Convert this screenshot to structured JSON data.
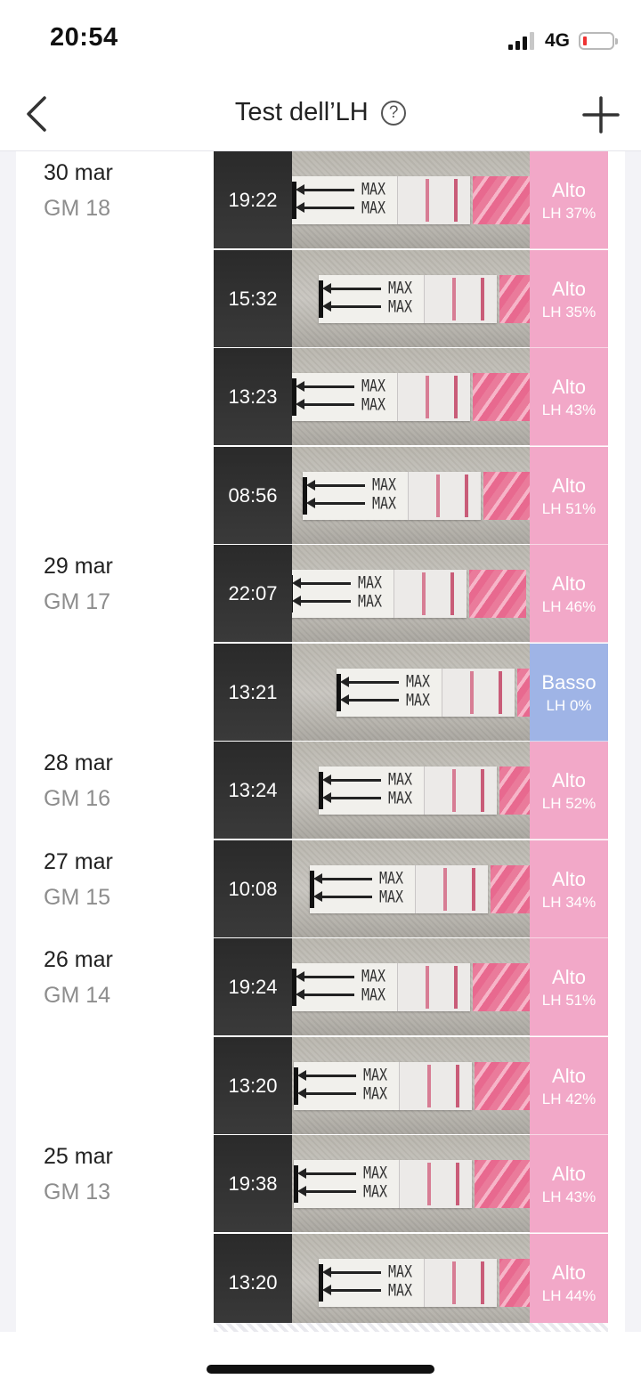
{
  "status_bar": {
    "time": "20:54",
    "network": "4G",
    "signal_bars": 3,
    "battery_level": "low"
  },
  "nav": {
    "title": "Test dell’LH",
    "back_icon": "chevron-left-icon",
    "help_icon": "question-circle-icon",
    "help_symbol": "?",
    "add_icon": "plus-icon"
  },
  "strip_label": "MAX",
  "entries": [
    {
      "date": "30 mar",
      "cycle_day": "GM 18",
      "time": "19:22",
      "level": "Alto",
      "lh": "LH 37%",
      "status": "high"
    },
    {
      "date": "",
      "cycle_day": "",
      "time": "15:32",
      "level": "Alto",
      "lh": "LH 35%",
      "status": "high"
    },
    {
      "date": "",
      "cycle_day": "",
      "time": "13:23",
      "level": "Alto",
      "lh": "LH 43%",
      "status": "high"
    },
    {
      "date": "",
      "cycle_day": "",
      "time": "08:56",
      "level": "Alto",
      "lh": "LH 51%",
      "status": "high"
    },
    {
      "date": "29 mar",
      "cycle_day": "GM 17",
      "time": "22:07",
      "level": "Alto",
      "lh": "LH 46%",
      "status": "high"
    },
    {
      "date": "",
      "cycle_day": "",
      "time": "13:21",
      "level": "Basso",
      "lh": "LH 0%",
      "status": "low"
    },
    {
      "date": "28 mar",
      "cycle_day": "GM 16",
      "time": "13:24",
      "level": "Alto",
      "lh": "LH 52%",
      "status": "high"
    },
    {
      "date": "27 mar",
      "cycle_day": "GM 15",
      "time": "10:08",
      "level": "Alto",
      "lh": "LH 34%",
      "status": "high"
    },
    {
      "date": "26 mar",
      "cycle_day": "GM 14",
      "time": "19:24",
      "level": "Alto",
      "lh": "LH 51%",
      "status": "high"
    },
    {
      "date": "",
      "cycle_day": "",
      "time": "13:20",
      "level": "Alto",
      "lh": "LH 42%",
      "status": "high"
    },
    {
      "date": "25 mar",
      "cycle_day": "GM 13",
      "time": "19:38",
      "level": "Alto",
      "lh": "LH 43%",
      "status": "high"
    },
    {
      "date": "",
      "cycle_day": "",
      "time": "13:20",
      "level": "Alto",
      "lh": "LH 44%",
      "status": "high"
    }
  ],
  "colors": {
    "high": "#f2a8c8",
    "low": "#9fb4e6"
  }
}
